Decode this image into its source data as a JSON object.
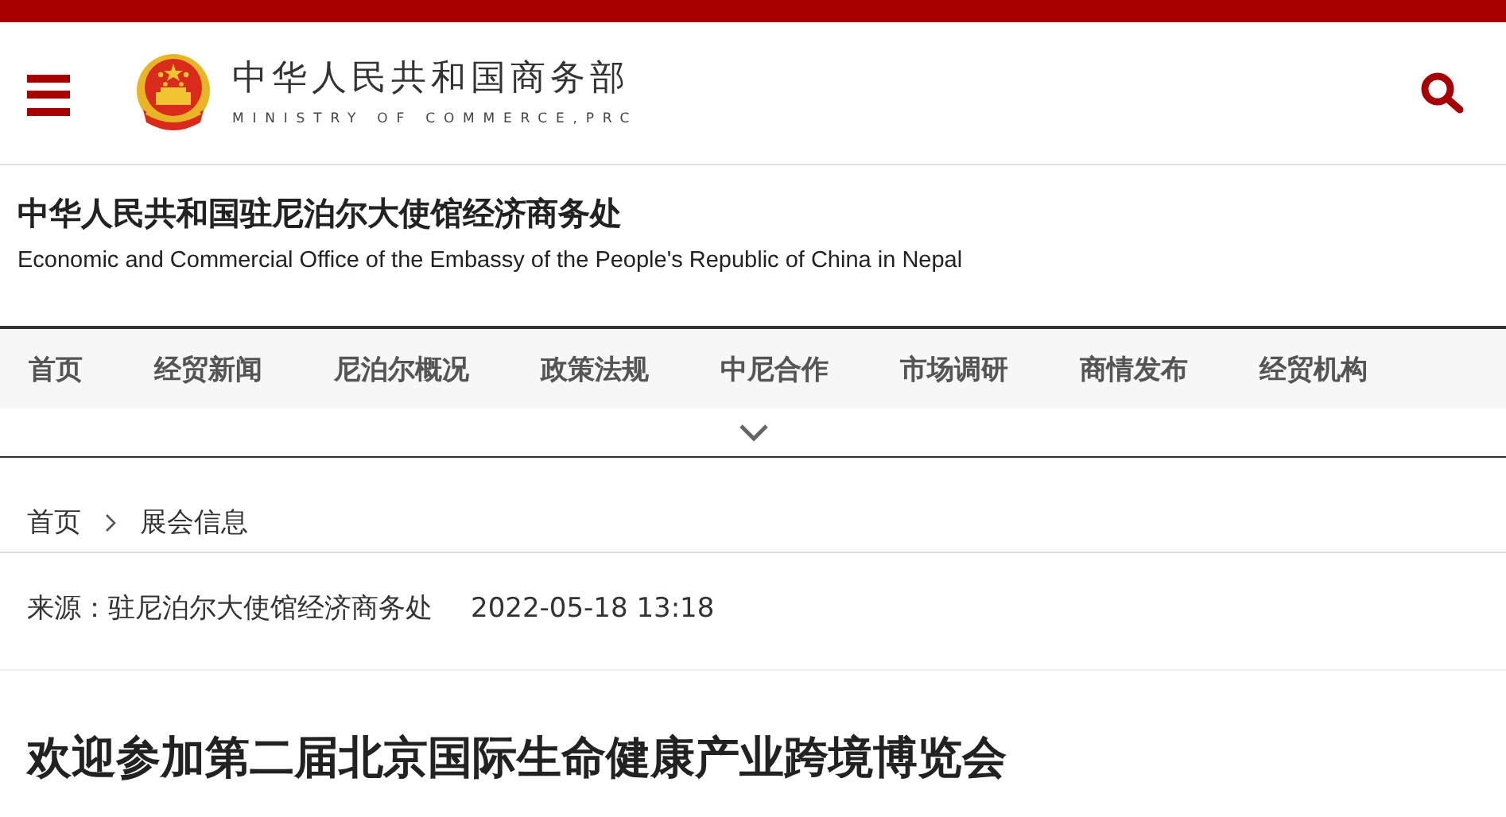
{
  "header": {
    "title": "中华人民共和国商务部",
    "subtitle": "MINISTRY OF COMMERCE,PRC"
  },
  "office": {
    "title": "中华人民共和国驻尼泊尔大使馆经济商务处",
    "subtitle": "Economic and Commercial Office of the Embassy of the People's Republic of China in Nepal"
  },
  "nav": {
    "items": [
      {
        "label": "首页"
      },
      {
        "label": "经贸新闻"
      },
      {
        "label": "尼泊尔概况"
      },
      {
        "label": "政策法规"
      },
      {
        "label": "中尼合作"
      },
      {
        "label": "市场调研"
      },
      {
        "label": "商情发布"
      },
      {
        "label": "经贸机构"
      }
    ],
    "expanded": false
  },
  "breadcrumb": [
    "首页",
    "展会信息"
  ],
  "article": {
    "source": "来源：驻尼泊尔大使馆经济商务处",
    "date": "2022-05-18 13:18",
    "title": "欢迎参加第二届北京国际生命健康产业跨境博览会"
  }
}
